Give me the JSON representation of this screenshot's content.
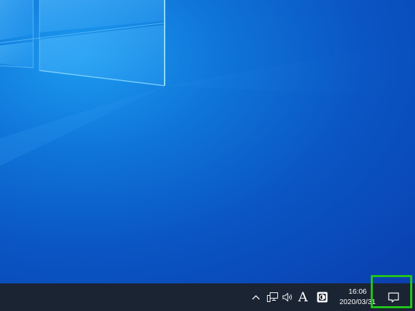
{
  "taskbar": {
    "tray": {
      "chevron_icon": "chevron-up-icon",
      "network_icon": "network-wired-icon",
      "volume_icon": "speaker-volume-icon",
      "ime_label": "A",
      "defender_icon": "security-shield-icon"
    },
    "clock": {
      "time": "16:06",
      "date": "2020/03/31"
    },
    "action_center_icon": "action-center-message-icon"
  },
  "highlight": {
    "color": "#22c51a"
  },
  "colors": {
    "taskbar_bg": "#1b2433",
    "desktop_accent": "#0f74d8"
  }
}
